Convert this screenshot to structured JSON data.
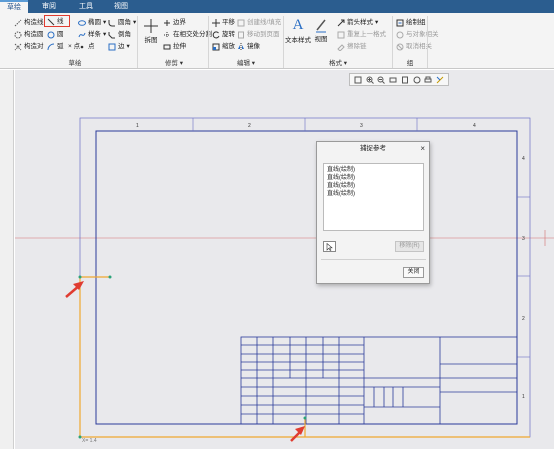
{
  "tabs": [
    "草绘",
    "审阅",
    "工具",
    "视图"
  ],
  "ribbon": {
    "col1": [
      "构造线",
      "构造圆",
      "构造对"
    ],
    "line_label": "线",
    "arc_label": "弧",
    "circle_label": "圆",
    "ellipse_label": "椭圆",
    "spline_label": "样条",
    "point_label": "点",
    "edge_label": "边",
    "fillet_label": "圆角",
    "chamfer_label": "倒角",
    "x_label": "× 点",
    "group_sketch": "草绘",
    "split_label": "拆图",
    "boundary_label": "边界",
    "intersect_label": "在相交处分割",
    "stretch_label": "拉伸",
    "group_trim": "修剪",
    "translate_label": "平移",
    "rotate_label": "旋转",
    "scale_label": "缩放",
    "dup_line_label": "创建线/填充",
    "move_page_label": "移动到页面",
    "mirror_label": "镜像",
    "group_edit": "编辑",
    "text_style_label": "文本样式",
    "view_label": "视图",
    "arrow_style_label": "箭头样式",
    "repeat_format_label": "重复上一格式",
    "erase_label": "擦除链",
    "group_format": "格式",
    "draw_group_label": "绘制组",
    "relate_view_label": "与对象相关",
    "cancel_relate_label": "取消相关",
    "group_group": "组"
  },
  "drawing": {
    "zones_top": [
      "1",
      "2",
      "3",
      "4"
    ],
    "zones_right": [
      "4",
      "3",
      "2",
      "1"
    ],
    "coord_text": "X= 1.4"
  },
  "dialog": {
    "title": "捕捉参考",
    "close_x": "×",
    "items": [
      "直线(绘制)",
      "直线(绘制)",
      "直线(绘制)",
      "直线(绘制)"
    ],
    "remove_label": "移除(R)",
    "close_button": "关闭"
  },
  "colors": {
    "tabbar": "#2b5d8f",
    "border_line": "#2a3a9a",
    "selection": "#f0a830",
    "arrow": "#e03c31"
  }
}
